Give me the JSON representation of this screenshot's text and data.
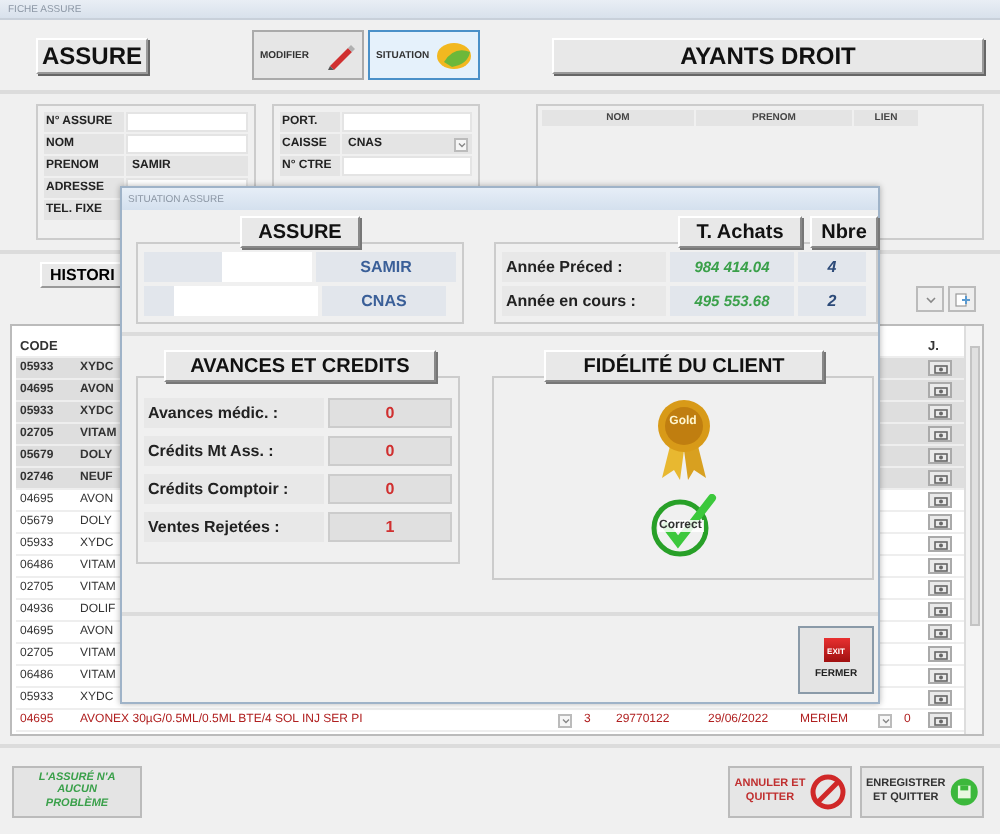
{
  "window": {
    "title": "FICHE ASSURE"
  },
  "header": {
    "title": "ASSURE",
    "buttons": [
      {
        "label": "MODIFIER",
        "kind": "edit",
        "selected": false
      },
      {
        "label": "SITUATION",
        "kind": "situation",
        "selected": true
      }
    ],
    "ayants_title": "AYANTS DROIT"
  },
  "assure_fields": [
    {
      "label": "N° ASSURE",
      "kind": "text"
    },
    {
      "label": "NOM",
      "kind": "text"
    },
    {
      "label": "PRENOM",
      "value": "SAMIR"
    },
    {
      "label": "ADRESSE",
      "kind": "text"
    },
    {
      "label": "TEL. FIXE"
    }
  ],
  "insurance_fields": [
    {
      "label": "PORT.",
      "kind": "text"
    },
    {
      "label": "CAISSE",
      "value": "CNAS",
      "kind": "dropdown"
    },
    {
      "label": "N° CTRE",
      "kind": "text"
    }
  ],
  "ayants_droit": {
    "columns": [
      "NOM",
      "PRENOM",
      "LIEN"
    ]
  },
  "history": {
    "button": "HISTORI"
  },
  "table": {
    "columns": [
      "CODE",
      "J."
    ],
    "rows": [
      {
        "code": "05933",
        "name": "XYDC",
        "highlighted": true,
        "rejected": false
      },
      {
        "code": "04695",
        "name": "AVON",
        "highlighted": true,
        "rejected": false
      },
      {
        "code": "05933",
        "name": "XYDC",
        "highlighted": true,
        "rejected": false
      },
      {
        "code": "02705",
        "name": "VITAM",
        "highlighted": true,
        "rejected": false
      },
      {
        "code": "05679",
        "name": "DOLY",
        "highlighted": true,
        "rejected": false
      },
      {
        "code": "02746",
        "name": "NEUF",
        "highlighted": true,
        "rejected": false
      },
      {
        "code": "04695",
        "name": "AVON",
        "highlighted": false,
        "rejected": false
      },
      {
        "code": "05679",
        "name": "DOLY",
        "highlighted": false,
        "rejected": false
      },
      {
        "code": "05933",
        "name": "XYDC",
        "highlighted": false,
        "rejected": false
      },
      {
        "code": "06486",
        "name": "VITAM",
        "highlighted": false,
        "rejected": false
      },
      {
        "code": "02705",
        "name": "VITAM",
        "highlighted": false,
        "rejected": false
      },
      {
        "code": "04936",
        "name": "DOLIF",
        "highlighted": false,
        "rejected": false
      },
      {
        "code": "04695",
        "name": "AVON",
        "highlighted": false,
        "rejected": false
      },
      {
        "code": "02705",
        "name": "VITAM",
        "highlighted": false,
        "rejected": false
      },
      {
        "code": "06486",
        "name": "VITAM",
        "highlighted": false,
        "rejected": false
      },
      {
        "code": "05933",
        "name": "XYDC",
        "highlighted": false,
        "rejected": false
      },
      {
        "code": "04695",
        "name": "AVONEX 30µG/0.5ML/0.5ML BTE/4 SOL INJ SER PI",
        "qty": "3",
        "number": "29770122",
        "date": "29/06/2022",
        "user": "MERIEM",
        "value": "0",
        "highlighted": false,
        "rejected": true
      }
    ]
  },
  "footer": {
    "status": "L'ASSURÉ N'A AUCUN PROBLÈME",
    "buttons": [
      {
        "label": "ANNULER ET QUITTER",
        "kind": "cancel"
      },
      {
        "label": "ENREGISTRER ET QUITTER",
        "kind": "save"
      }
    ]
  },
  "dialog": {
    "title": "SITUATION ASSURE",
    "assure": {
      "title": "ASSURE",
      "values": [
        "SAMIR",
        "CNAS"
      ]
    },
    "purchases": {
      "columns": [
        "T. Achats",
        "Nbre"
      ],
      "rows": [
        {
          "label": "Année Préced :",
          "total": "984 414.04",
          "count": "4"
        },
        {
          "label": "Année en cours :",
          "total": "495 553.68",
          "count": "2"
        }
      ]
    },
    "credits": {
      "title": "AVANCES ET CREDITS",
      "rows": [
        {
          "label": "Avances médic. :",
          "value": "0"
        },
        {
          "label": "Crédits Mt Ass. :",
          "value": "0"
        },
        {
          "label": "Crédits Comptoir :",
          "value": "0"
        },
        {
          "label": "Ventes Rejetées :",
          "value": "1"
        }
      ]
    },
    "loyalty": {
      "title": "FIDÉLITÉ DU CLIENT",
      "badge": "Gold",
      "status": "Correct"
    },
    "close": {
      "label": "FERMER",
      "icon_text": "EXIT"
    }
  }
}
